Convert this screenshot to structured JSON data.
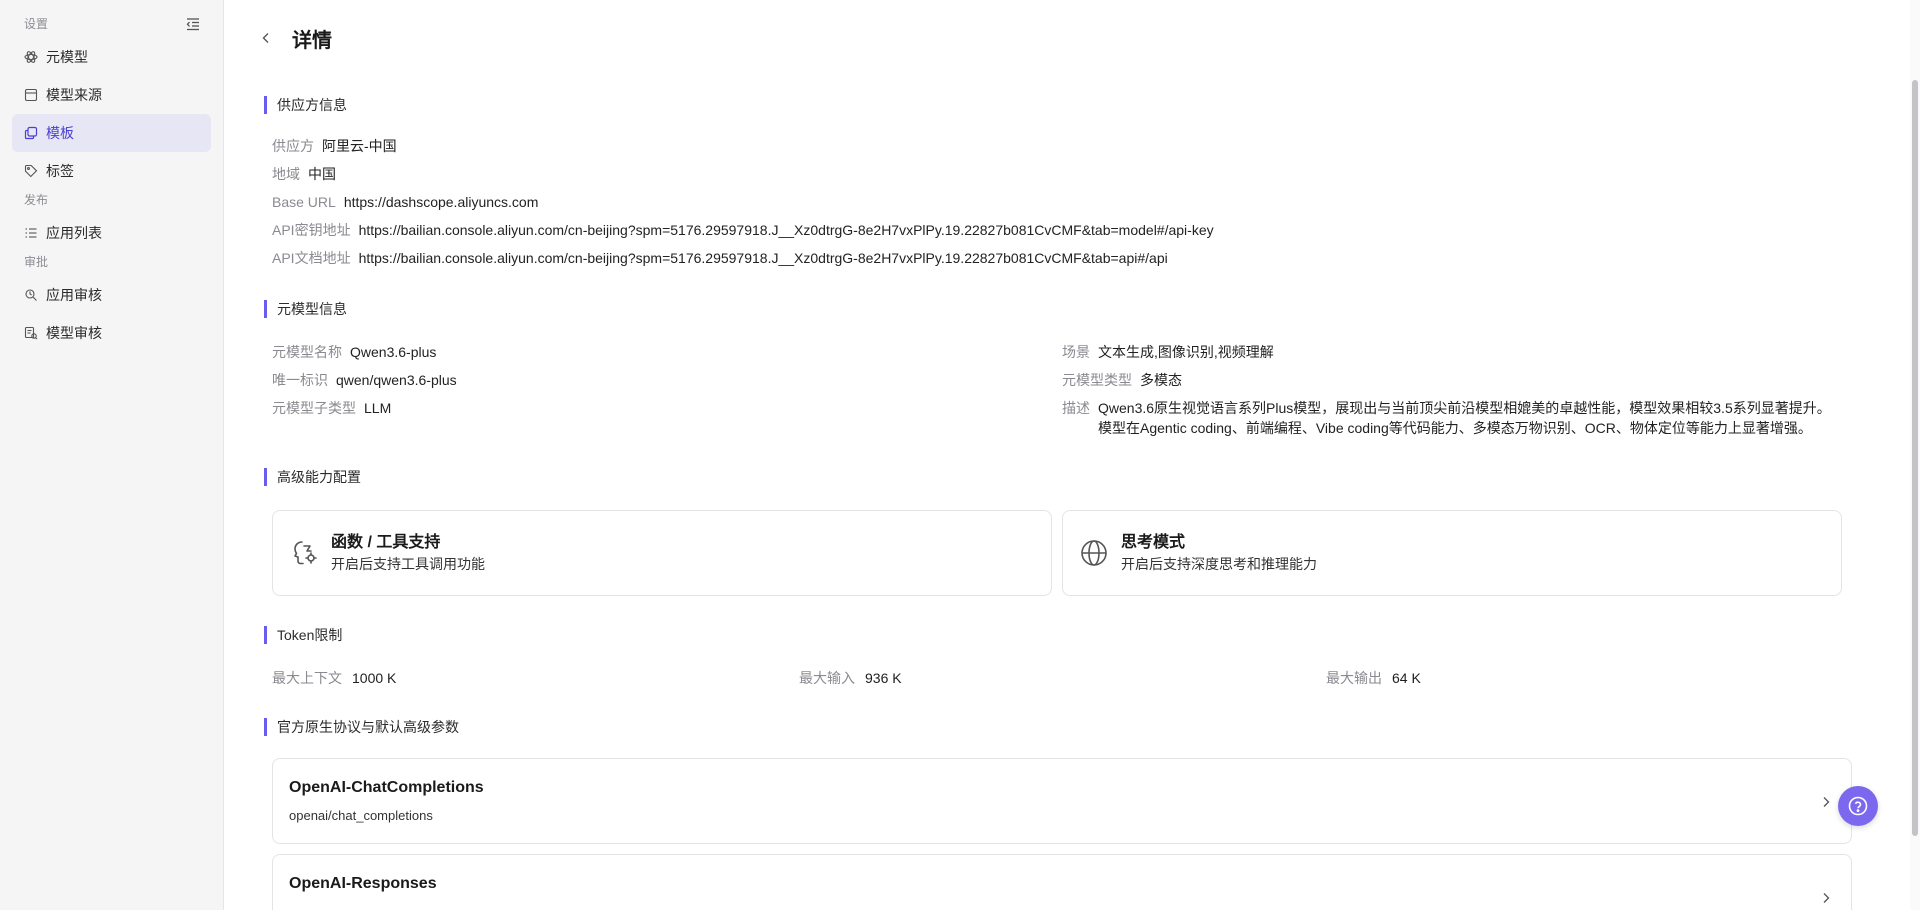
{
  "sidebar": {
    "sections": [
      {
        "label": "设置",
        "items": [
          {
            "label": "元模型",
            "icon": "atom-icon"
          },
          {
            "label": "模型来源",
            "icon": "window-icon"
          },
          {
            "label": "模板",
            "icon": "copy-icon",
            "active": true
          },
          {
            "label": "标签",
            "icon": "tag-icon"
          }
        ]
      },
      {
        "label": "发布",
        "items": [
          {
            "label": "应用列表",
            "icon": "list-icon"
          }
        ]
      },
      {
        "label": "审批",
        "items": [
          {
            "label": "应用审核",
            "icon": "app-review-icon"
          },
          {
            "label": "模型审核",
            "icon": "model-review-icon"
          }
        ]
      }
    ]
  },
  "header": {
    "title": "详情"
  },
  "provider": {
    "section_title": "供应方信息",
    "supplier_label": "供应方",
    "supplier_value": "阿里云-中国",
    "region_label": "地域",
    "region_value": "中国",
    "base_url_label": "Base URL",
    "base_url_value": "https://dashscope.aliyuncs.com",
    "api_key_label": "API密钥地址",
    "api_key_value": "https://bailian.console.aliyun.com/cn-beijing?spm=5176.29597918.J__Xz0dtrgG-8e2H7vxPlPy.19.22827b081CvCMF&tab=model#/api-key",
    "api_doc_label": "API文档地址",
    "api_doc_value": "https://bailian.console.aliyun.com/cn-beijing?spm=5176.29597918.J__Xz0dtrgG-8e2H7vxPlPy.19.22827b081CvCMF&tab=api#/api"
  },
  "meta_model": {
    "section_title": "元模型信息",
    "name_label": "元模型名称",
    "name_value": "Qwen3.6-plus",
    "id_label": "唯一标识",
    "id_value": "qwen/qwen3.6-plus",
    "subtype_label": "元模型子类型",
    "subtype_value": "LLM",
    "scene_label": "场景",
    "scene_value": "文本生成,图像识别,视频理解",
    "type_label": "元模型类型",
    "type_value": "多模态",
    "desc_label": "描述",
    "desc_line1": "Qwen3.6原生视觉语言系列Plus模型，展现出与当前顶尖前沿模型相媲美的卓越性能，模型效果相较3.5系列显著提升。",
    "desc_line2": "模型在Agentic coding、前端编程、Vibe coding等代码能力、多模态万物识别、OCR、物体定位等能力上显著增强。"
  },
  "advanced": {
    "section_title": "高级能力配置",
    "cards": [
      {
        "title": "函数 / 工具支持",
        "desc": "开启后支持工具调用功能",
        "icon": "function-tool-icon"
      },
      {
        "title": "思考模式",
        "desc": "开启后支持深度思考和推理能力",
        "icon": "globe-icon"
      }
    ]
  },
  "token": {
    "section_title": "Token限制",
    "max_context_label": "最大上下文",
    "max_context_value": "1000 K",
    "max_input_label": "最大输入",
    "max_input_value": "936 K",
    "max_output_label": "最大输出",
    "max_output_value": "64 K"
  },
  "protocols": {
    "section_title": "官方原生协议与默认高级参数",
    "items": [
      {
        "title": "OpenAI-ChatCompletions",
        "sub": "openai/chat_completions"
      },
      {
        "title": "OpenAI-Responses",
        "sub": ""
      }
    ]
  },
  "colors": {
    "accent": "#6b5cf0",
    "active_bg": "#e6e6f5",
    "help_button": "#7b68ee"
  }
}
